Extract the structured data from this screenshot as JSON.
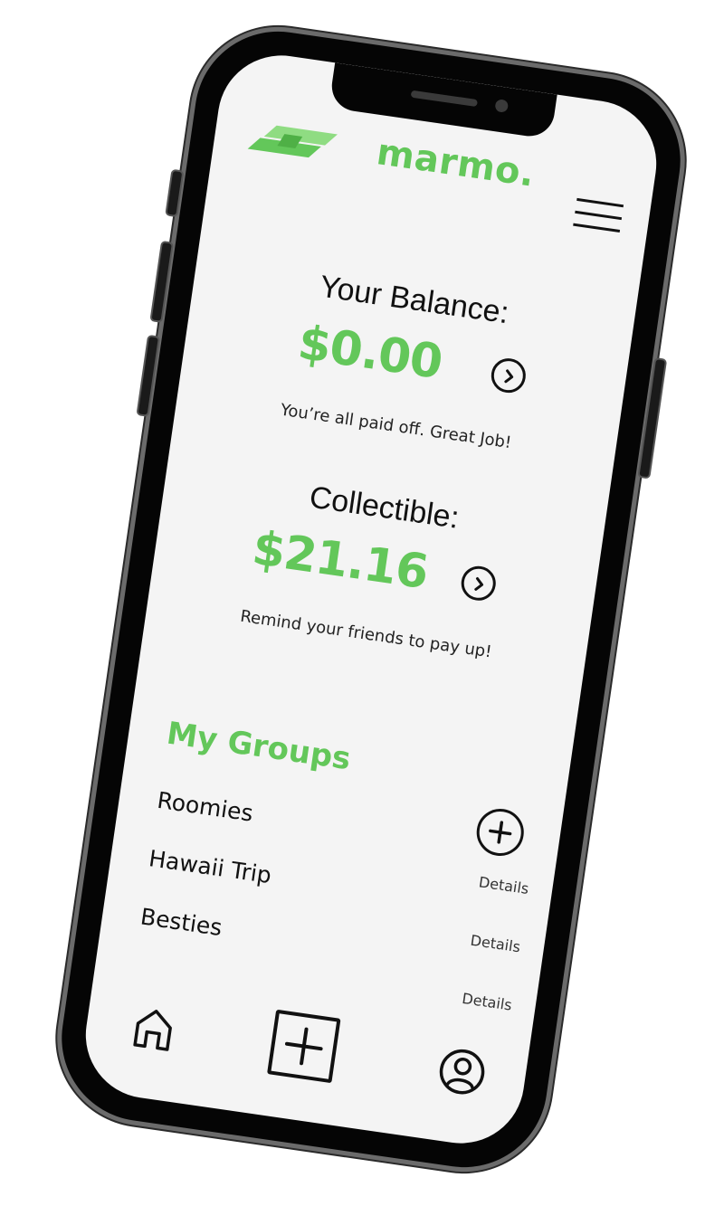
{
  "app": {
    "brand": "marmo."
  },
  "balance": {
    "heading": "Your Balance:",
    "amount": "$0.00",
    "message": "You’re all paid off. Great Job!"
  },
  "collectible": {
    "heading": "Collectible:",
    "amount": "$21.16",
    "message": "Remind your friends to pay up!"
  },
  "groups": {
    "title": "My Groups",
    "items": [
      {
        "name": "Roomies",
        "details_label": "Details"
      },
      {
        "name": "Hawaii Trip",
        "details_label": "Details"
      },
      {
        "name": "Besties",
        "details_label": "Details"
      }
    ]
  },
  "colors": {
    "accent": "#63c75a",
    "screen_bg": "#f4f4f4",
    "frame": "#050505"
  },
  "icons": {
    "menu": "hamburger-icon",
    "balance_go": "chevron-right-icon",
    "collectible_go": "chevron-right-icon",
    "add_group": "plus-circle-icon",
    "nav_home": "home-icon",
    "nav_add": "plus-square-icon",
    "nav_profile": "user-circle-icon"
  }
}
